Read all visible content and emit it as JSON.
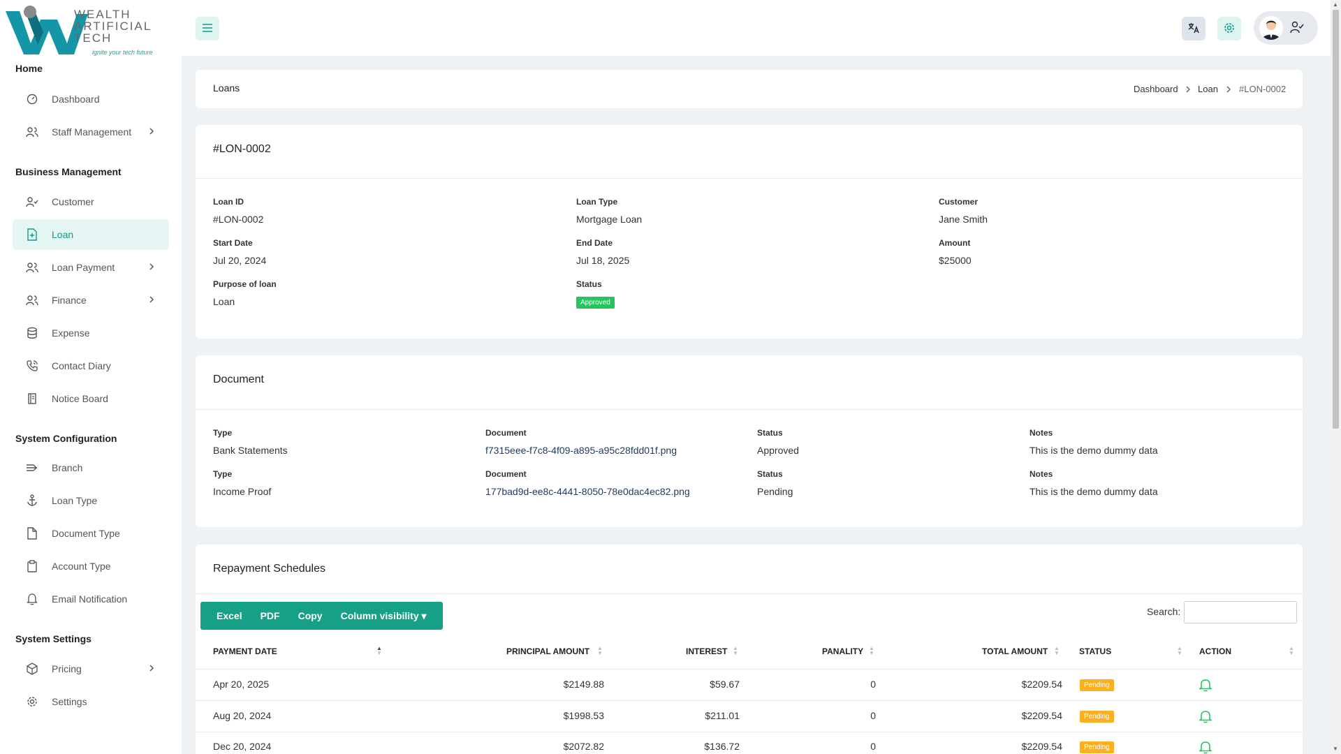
{
  "brand": {
    "line1": "WEALTH",
    "line2": "ARTIFICIAL",
    "line3": "TECH",
    "tagline": "ignite your tech future"
  },
  "sidebar": {
    "sections": {
      "home": "Home",
      "business": "Business Management",
      "system_config": "System Configuration",
      "system_settings": "System Settings"
    },
    "items": {
      "dashboard": "Dashboard",
      "staff_management": "Staff Management",
      "customer": "Customer",
      "loan": "Loan",
      "loan_payment": "Loan Payment",
      "finance": "Finance",
      "expense": "Expense",
      "contact_diary": "Contact Diary",
      "notice_board": "Notice Board",
      "branch": "Branch",
      "loan_type": "Loan Type",
      "document_type": "Document Type",
      "account_type": "Account Type",
      "email_notification": "Email Notification",
      "pricing": "Pricing",
      "settings": "Settings"
    }
  },
  "header": {
    "page_title": "Loans",
    "breadcrumb": [
      "Dashboard",
      "Loan",
      "#LON-0002"
    ]
  },
  "loan": {
    "title": "#LON-0002",
    "fields": {
      "loan_id_label": "Loan ID",
      "loan_id": "#LON-0002",
      "loan_type_label": "Loan Type",
      "loan_type": "Mortgage Loan",
      "customer_label": "Customer",
      "customer": "Jane Smith",
      "start_date_label": "Start Date",
      "start_date": "Jul 20, 2024",
      "end_date_label": "End Date",
      "end_date": "Jul 18, 2025",
      "amount_label": "Amount",
      "amount": "$25000",
      "purpose_label": "Purpose of loan",
      "purpose": "Loan",
      "status_label": "Status",
      "status": "Approved"
    }
  },
  "documents": {
    "title": "Document",
    "rows": [
      {
        "type_label": "Type",
        "type": "Bank Statements",
        "doc_label": "Document",
        "doc": "f7315eee-f7c8-4f09-a895-a95c28fdd01f.png",
        "status_label": "Status",
        "status": "Approved",
        "notes_label": "Notes",
        "notes": "This is the demo dummy data"
      },
      {
        "type_label": "Type",
        "type": "Income Proof",
        "doc_label": "Document",
        "doc": "177bad9d-ee8c-4441-8050-78e0dac4ec82.png",
        "status_label": "Status",
        "status": "Pending",
        "notes_label": "Notes",
        "notes": "This is the demo dummy data"
      }
    ]
  },
  "schedules": {
    "title": "Repayment Schedules",
    "buttons": {
      "excel": "Excel",
      "pdf": "PDF",
      "copy": "Copy",
      "column_visibility": "Column visibility"
    },
    "search_label": "Search:",
    "columns": {
      "payment_date": "PAYMENT DATE",
      "principal": "PRINCIPAL AMOUNT",
      "interest": "INTEREST",
      "penality": "PANALITY",
      "total": "TOTAL AMOUNT",
      "status": "STATUS",
      "action": "ACTION"
    },
    "rows": [
      {
        "date": "Apr 20, 2025",
        "principal": "$2149.88",
        "interest": "$59.67",
        "penality": "0",
        "total": "$2209.54",
        "status": "Pending"
      },
      {
        "date": "Aug 20, 2024",
        "principal": "$1998.53",
        "interest": "$211.01",
        "penality": "0",
        "total": "$2209.54",
        "status": "Pending"
      },
      {
        "date": "Dec 20, 2024",
        "principal": "$2072.82",
        "interest": "$136.72",
        "penality": "0",
        "total": "$2209.54",
        "status": "Pending"
      }
    ]
  },
  "colors": {
    "accent": "#16a085",
    "accent_light": "#e4f5f3",
    "approved": "#22c55e",
    "pending": "#fbb11f"
  }
}
